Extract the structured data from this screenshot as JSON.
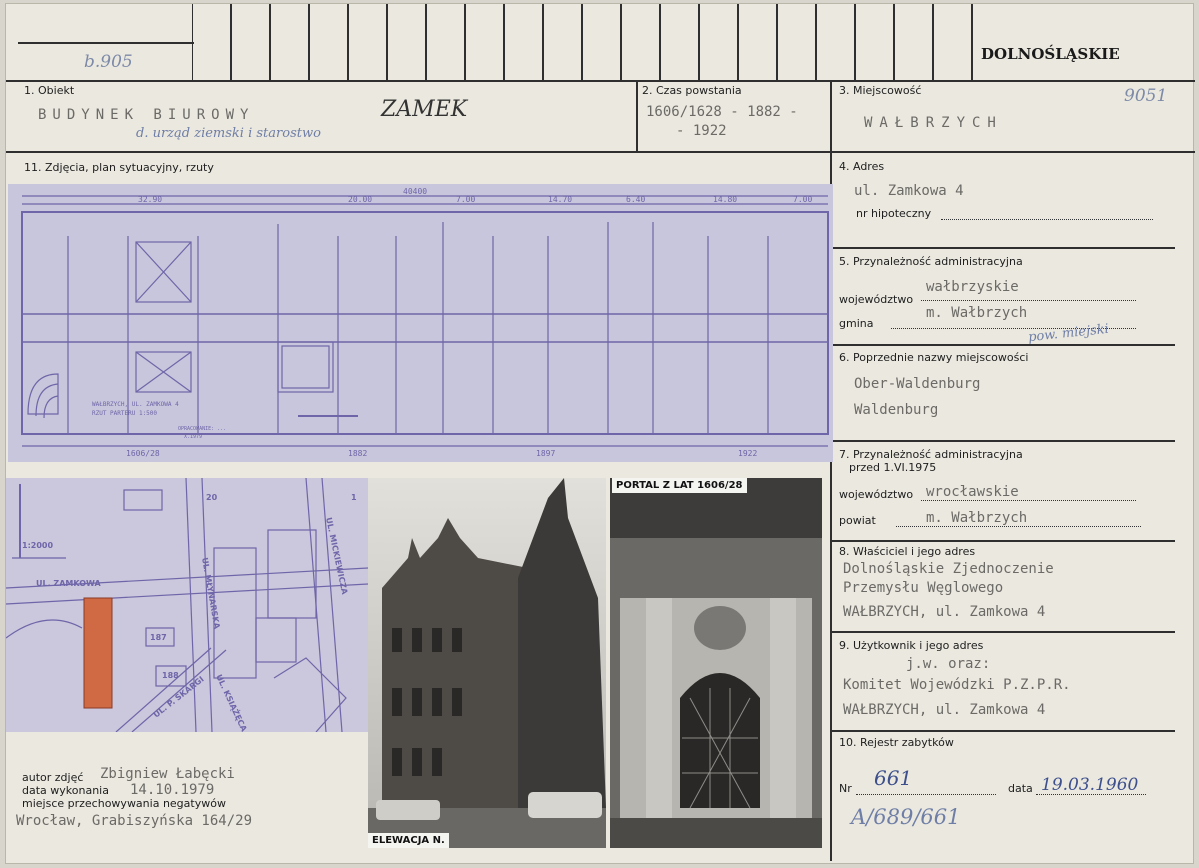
{
  "region": "DOLNOŚLĄSKIE",
  "inventory_note": "b.905",
  "top_right_note": "9051",
  "f1": {
    "label": "1. Obiekt",
    "typed": "BUDYNEK BIUROWY",
    "hand1": "ZAMEK",
    "hand2": "d. urząd ziemski i starostwo"
  },
  "f2": {
    "label": "2. Czas powstania",
    "line1": "1606/1628 - 1882 -",
    "line2": "- 1922"
  },
  "f3": {
    "label": "3. Miejscowość",
    "value": "WAŁBRZYCH"
  },
  "f11": {
    "label": "11. Zdjęcia, plan sytuacyjny, rzuty"
  },
  "f4": {
    "label": "4. Adres",
    "value": "ul. Zamkowa 4",
    "hipo_label": "nr hipoteczny"
  },
  "f5": {
    "label": "5. Przynależność administracyjna",
    "woj_label": "województwo",
    "woj_value": "wałbrzyskie",
    "gmina_label": "gmina",
    "gmina_value": "m. Wałbrzych",
    "hand_note": "pow. miejski"
  },
  "f6": {
    "label": "6. Poprzednie nazwy miejscowości",
    "names": [
      "Ober-Waldenburg",
      "Waldenburg"
    ]
  },
  "f7": {
    "label": "7. Przynależność administracyjna",
    "sub": "przed 1.VI.1975",
    "woj_label": "województwo",
    "woj_value": "wrocławskie",
    "powiat_label": "powiat",
    "powiat_value": "m. Wałbrzych"
  },
  "f8": {
    "label": "8. Właściciel i jego adres",
    "lines": [
      "Dolnośląskie Zjednoczenie",
      "Przemysłu Węglowego",
      "WAŁBRZYCH, ul. Zamkowa 4"
    ]
  },
  "f9": {
    "label": "9. Użytkownik i jego adres",
    "lines": [
      "j.w. oraz:",
      "Komitet Wojewódzki P.Z.P.R.",
      "WAŁBRZYCH, ul. Zamkowa 4"
    ]
  },
  "f10": {
    "label": "10. Rejestr zabytków",
    "nr_label": "Nr",
    "nr_value": "661",
    "data_label": "data",
    "data_value": "19.03.1960",
    "hand_note": "A/689/661"
  },
  "plan": {
    "total_dim": "40400",
    "dims": [
      "32.90",
      "20.00",
      "7.00",
      "14.70",
      "6.40",
      "14.80",
      "7.00"
    ],
    "caption1": "WAŁBRZYCH, UL. ZAMKOWA 4",
    "caption2": "RZUT PARTERU 1:500",
    "caption3": "OPRACOWANIE: ...",
    "caption4": "X.1979",
    "phases": [
      "1606/28",
      "1882",
      "1897",
      "1922"
    ]
  },
  "map": {
    "scale": "1:2000",
    "streets": [
      "UL. ZAMKOWA",
      "UL. MŁYNARSKA",
      "UL. MICKIEWICZA",
      "UL. KSIĄŻĘCA",
      "UL. P. SKARGI"
    ],
    "plots": [
      "187",
      "188",
      "20",
      "1"
    ]
  },
  "photos": {
    "portal_caption": "PORTAL Z LAT 1606/28",
    "elevation_caption": "ELEWACJA N."
  },
  "credits": {
    "author_label": "autor zdjęć",
    "author_value": "Zbigniew Łabęcki",
    "date_label": "data wykonania",
    "date_value": "14.10.1979",
    "storage_label": "miejsce przechowywania negatywów",
    "storage_value": "Wrocław, Grabiszyńska 164/29"
  }
}
